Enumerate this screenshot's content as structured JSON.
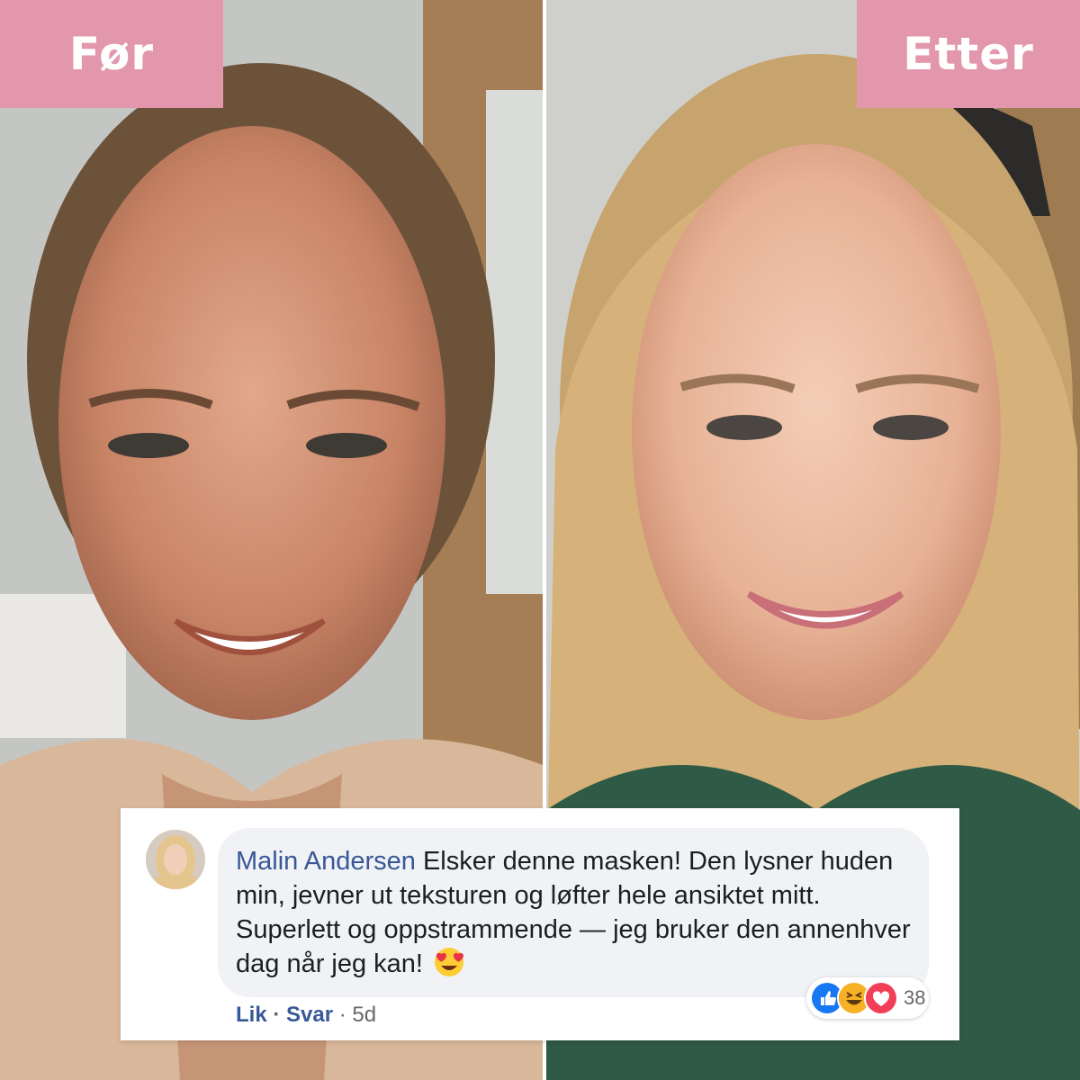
{
  "labels": {
    "before": "Før",
    "after": "Etter"
  },
  "colors": {
    "label_bg": "#e397ad",
    "author_link": "#385898",
    "bubble_bg": "#f0f2f5"
  },
  "comment": {
    "author": "Malin Andersen",
    "text": "Elsker denne masken! Den lysner huden min, jevner ut teksturen og løfter hele ansiktet mitt. Superlett og oppstrammende — jeg bruker den annenhver dag når jeg kan!",
    "emoji": "heart-eyes-emoji",
    "reaction_icons": [
      "like-icon",
      "haha-icon",
      "love-icon"
    ],
    "reaction_count": "38",
    "actions": {
      "like": "Lik",
      "reply": "Svar",
      "time": "5d"
    }
  }
}
